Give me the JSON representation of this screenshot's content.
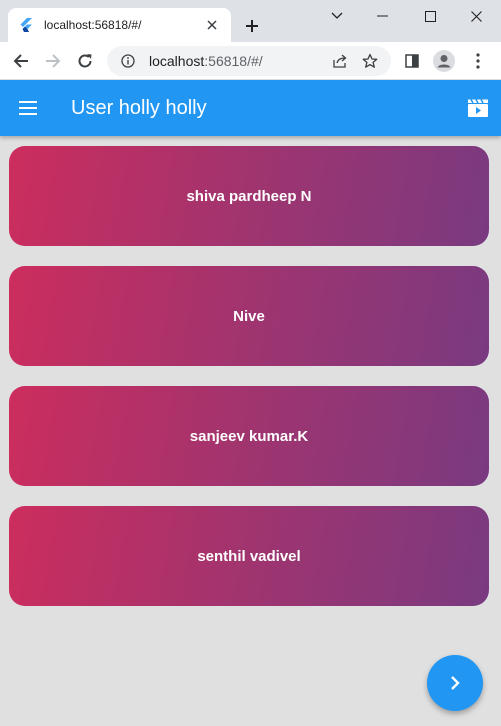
{
  "browser": {
    "tab_title": "localhost:56818/#/",
    "url_host": "localhost",
    "url_rest": ":56818/#/"
  },
  "app": {
    "title": "User holly holly",
    "users": [
      {
        "name": "shiva pardheep N"
      },
      {
        "name": "Nive"
      },
      {
        "name": "sanjeev kumar.K"
      },
      {
        "name": "senthil vadivel"
      }
    ],
    "colors": {
      "appbar": "#2196f3",
      "background": "#e0e0e0",
      "card_gradient_start": "#cc2d5d",
      "card_gradient_end": "#7a3a80"
    }
  }
}
